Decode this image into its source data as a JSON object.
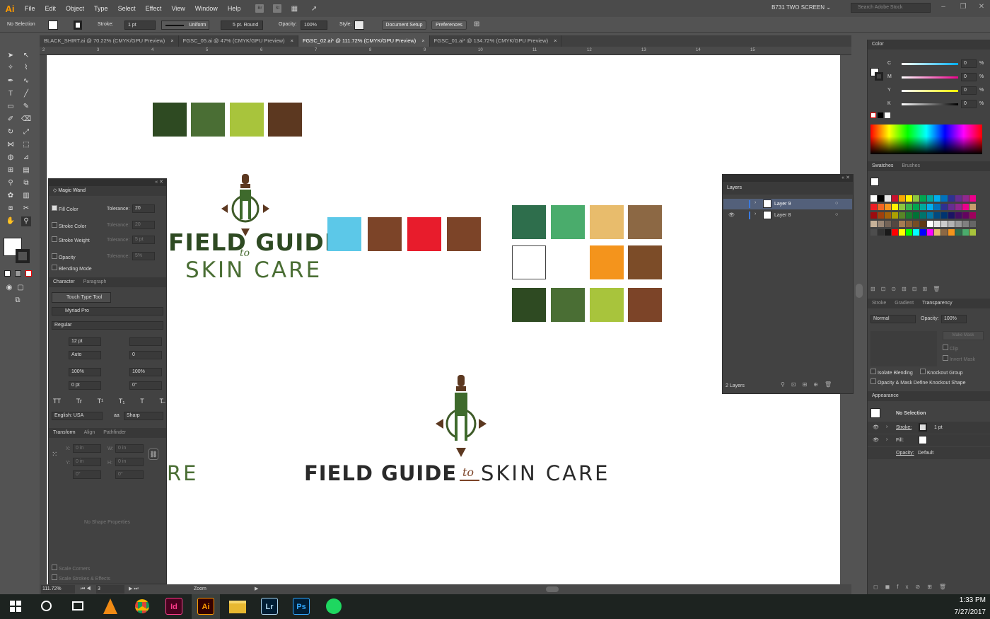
{
  "app": {
    "logo": "Ai"
  },
  "menu": [
    "File",
    "Edit",
    "Object",
    "Type",
    "Select",
    "Effect",
    "View",
    "Window",
    "Help"
  ],
  "menu_badges": [
    "Br",
    "St"
  ],
  "workspace": "B731 TWO SCREEN",
  "stock_search_placeholder": "Search Adobe Stock",
  "control": {
    "selection": "No Selection",
    "stroke_label": "Stroke:",
    "stroke_value": "1 pt",
    "profile": "Uniform",
    "brush": "5 pt. Round",
    "opacity_label": "Opacity:",
    "opacity_value": "100%",
    "style_label": "Style:",
    "doc_setup": "Document Setup",
    "preferences": "Preferences"
  },
  "tabs": [
    {
      "label": "BLACK_SHIRT.ai @ 70.22% (CMYK/GPU Preview)",
      "active": false
    },
    {
      "label": "FGSC_05.ai @ 47% (CMYK/GPU Preview)",
      "active": false
    },
    {
      "label": "FGSC_02.ai* @ 111.72% (CMYK/GPU Preview)",
      "active": true
    },
    {
      "label": "FGSC_01.ai* @ 134.72% (CMYK/GPU Preview)",
      "active": false
    }
  ],
  "ruler_numbers": [
    "2",
    "3",
    "4",
    "5",
    "6",
    "7",
    "8",
    "9",
    "10",
    "11",
    "12",
    "13",
    "14",
    "15"
  ],
  "artboard": {
    "logo1_line1": "FIELD GUIDE",
    "logo1_to": "to",
    "logo1_line2": "SKIN CARE",
    "logo2_part1": "FIELD GUIDE",
    "logo2_to": "to",
    "logo2_part2": "SKIN CARE",
    "partial_text": "RE",
    "colors": {
      "dark_green": "#2e4a22",
      "mid_green": "#4a6e34",
      "lime": "#a8c43c",
      "brown": "#5c3820",
      "sky": "#5cc8e8",
      "rust": "#7c4428",
      "red": "#e81c2c",
      "teal_green": "#2e6e4c",
      "bright_green": "#4aac6c",
      "sand": "#e8bc6c",
      "tan": "#8c6844",
      "orange": "#f4941c"
    }
  },
  "magic_wand": {
    "title": "Magic Wand",
    "fill_color": "Fill Color",
    "tolerance_label": "Tolerance:",
    "tolerance_value": "20",
    "stroke_color": "Stroke Color",
    "stroke_weight": "Stroke Weight",
    "opacity": "Opacity",
    "blending_mode": "Blending Mode",
    "tol2": "20",
    "tol3": "5 pt",
    "tol4": "5%"
  },
  "character": {
    "tab1": "Character",
    "tab2": "Paragraph",
    "touch_type": "Touch Type Tool",
    "font": "Myriad Pro",
    "style": "Regular",
    "size": "12 pt",
    "leading": "",
    "kerning": "Auto",
    "tracking": "0",
    "vscale": "100%",
    "hscale": "100%",
    "baseline": "0 pt",
    "rotation": "0°",
    "tt_row": [
      "TT",
      "Tr",
      "T¹",
      "T₁",
      "T",
      "T̶"
    ],
    "language": "English: USA",
    "aa_label": "aa",
    "aa": "Sharp"
  },
  "transform": {
    "tab1": "Transform",
    "tab2": "Align",
    "tab3": "Pathfinder",
    "x_label": "X:",
    "x": "0 in",
    "w_label": "W:",
    "w": "0 in",
    "y_label": "Y:",
    "y": "0 in",
    "h_label": "H:",
    "h": "0 in",
    "angle": "0°",
    "shear": "0°",
    "no_shape": "No Shape Properties",
    "scale_corners": "Scale Corners",
    "scale_strokes": "Scale Strokes & Effects"
  },
  "layers": {
    "title": "Layers",
    "items": [
      "Layer 9",
      "Layer 8"
    ],
    "count": "2 Layers"
  },
  "color_panel": {
    "title": "Color",
    "channels": [
      {
        "name": "C",
        "value": "0"
      },
      {
        "name": "M",
        "value": "0"
      },
      {
        "name": "Y",
        "value": "0"
      },
      {
        "name": "K",
        "value": "0"
      }
    ],
    "unit": "%"
  },
  "swatches": {
    "tab1": "Swatches",
    "tab2": "Brushes"
  },
  "transparency": {
    "tab1": "Stroke",
    "tab2": "Gradient",
    "tab3": "Transparency",
    "mode": "Normal",
    "opacity_label": "Opacity:",
    "opacity": "100%",
    "make_mask": "Make Mask",
    "clip": "Clip",
    "invert": "Invert Mask",
    "isolate": "Isolate Blending",
    "knockout": "Knockout Group",
    "opacity_mask": "Opacity & Mask Define Knockout Shape"
  },
  "appearance": {
    "title": "Appearance",
    "selection": "No Selection",
    "stroke_label": "Stroke:",
    "stroke_value": "1 pt",
    "fill_label": "Fill:",
    "opacity_label": "Opacity:",
    "opacity_value": "Default"
  },
  "status": {
    "zoom": "111.72%",
    "artboard": "3",
    "tool": "Zoom"
  },
  "taskbar": {
    "time": "1:33 PM",
    "date": "7/27/2017",
    "apps": [
      "Id",
      "Ai",
      "Lr",
      "Ps"
    ]
  }
}
